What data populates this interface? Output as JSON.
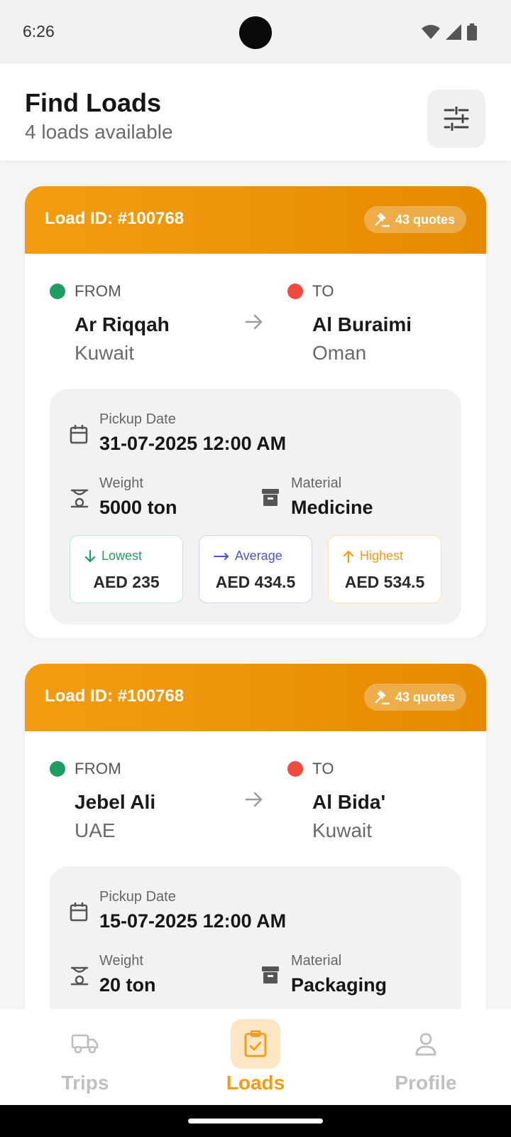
{
  "status_bar": {
    "time": "6:26"
  },
  "header": {
    "title": "Find Loads",
    "subtitle": "4 loads available"
  },
  "loads": [
    {
      "load_id": "Load ID: #100768",
      "quotes": "43 quotes",
      "from_label": "FROM",
      "from_city": "Ar Riqqah",
      "from_country": "Kuwait",
      "to_label": "TO",
      "to_city": "Al Buraimi",
      "to_country": "Oman",
      "pickup_label": "Pickup Date",
      "pickup_date": "31-07-2025 12:00 AM",
      "weight_label": "Weight",
      "weight": "5000 ton",
      "material_label": "Material",
      "material": "Medicine",
      "lowest_label": "Lowest",
      "lowest": "AED 235",
      "average_label": "Average",
      "average": "AED 434.5",
      "highest_label": "Highest",
      "highest": "AED 534.5"
    },
    {
      "load_id": "Load ID: #100768",
      "quotes": "43 quotes",
      "from_label": "FROM",
      "from_city": "Jebel Ali",
      "from_country": "UAE",
      "to_label": "TO",
      "to_city": "Al Bida'",
      "to_country": "Kuwait",
      "pickup_label": "Pickup Date",
      "pickup_date": "15-07-2025 12:00 AM",
      "weight_label": "Weight",
      "weight": "20 ton",
      "material_label": "Material",
      "material": "Packaging"
    }
  ],
  "nav": {
    "trips": "Trips",
    "loads": "Loads",
    "profile": "Profile",
    "active": "loads"
  },
  "colors": {
    "accent": "#f39c12",
    "from_dot": "#1e9e62",
    "to_dot": "#f04b3f",
    "lowest": "#1e9e62",
    "average": "#4a56c8",
    "highest": "#f39c12"
  }
}
